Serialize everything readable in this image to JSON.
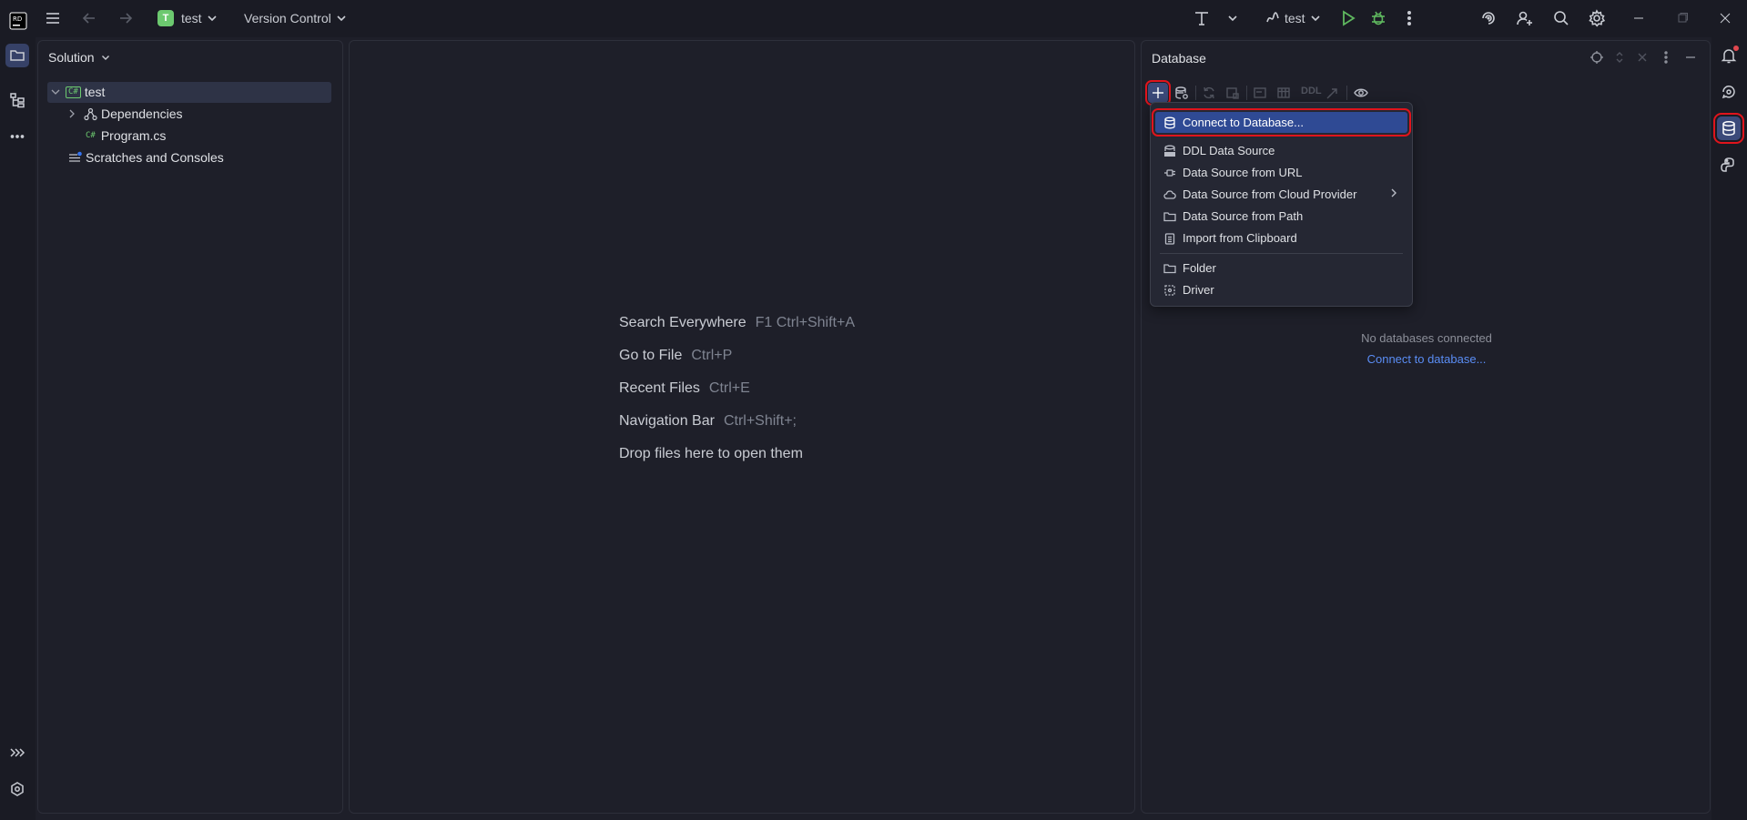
{
  "titlebar": {
    "project_initial": "T",
    "project_name": "test",
    "vcs_label": "Version Control",
    "run_config": "test",
    "icons": [
      "app-logo-icon",
      "hamburger-menu-icon",
      "back-arrow-icon",
      "forward-arrow-icon",
      "chevron-down-icon",
      "text-tool-icon",
      "run-icon",
      "debug-icon",
      "more-vertical-icon",
      "ai-assistant-icon",
      "add-user-icon",
      "search-icon",
      "gear-icon",
      "minimize-icon",
      "restore-icon",
      "close-icon"
    ]
  },
  "left_strip": {
    "icons": [
      "folder-icon",
      "structure-icon",
      "more-horizontal-icon",
      "expand-icon",
      "services-icon"
    ]
  },
  "solution": {
    "title": "Solution",
    "tree": [
      {
        "label": "test",
        "badge": "C#"
      },
      {
        "label": "Dependencies"
      },
      {
        "label": "Program.cs",
        "badge": "C#"
      },
      {
        "label": "Scratches and Consoles"
      }
    ]
  },
  "editor": {
    "hints": [
      {
        "label": "Search Everywhere",
        "key": "F1 Ctrl+Shift+A"
      },
      {
        "label": "Go to File",
        "key": "Ctrl+P"
      },
      {
        "label": "Recent Files",
        "key": "Ctrl+E"
      },
      {
        "label": "Navigation Bar",
        "key": "Ctrl+Shift+;"
      },
      {
        "label": "Drop files here to open them",
        "key": ""
      }
    ]
  },
  "database": {
    "title": "Database",
    "toolbar_ddl": "DDL",
    "empty_text": "No databases connected",
    "connect_link": "Connect to database...",
    "menu": [
      {
        "label": "Connect to Database...",
        "icon": "database-icon"
      },
      {
        "label": "DDL Data Source",
        "icon": "ddl-icon"
      },
      {
        "label": "Data Source from URL",
        "icon": "plug-icon"
      },
      {
        "label": "Data Source from Cloud Provider",
        "icon": "cloud-icon"
      },
      {
        "label": "Data Source from Path",
        "icon": "folder-icon"
      },
      {
        "label": "Import from Clipboard",
        "icon": "clipboard-icon"
      },
      {
        "label": "Folder",
        "icon": "folder-icon"
      },
      {
        "label": "Driver",
        "icon": "driver-icon"
      }
    ]
  },
  "right_strip": {
    "icons": [
      "notifications-icon",
      "ai-chat-icon",
      "database-icon",
      "python-icon"
    ]
  },
  "colors": {
    "background": "#1e1f29",
    "accent": "#3b4a7a",
    "selection": "#2f4a94",
    "highlight_box": "#e0141c",
    "link": "#5a8df5"
  }
}
